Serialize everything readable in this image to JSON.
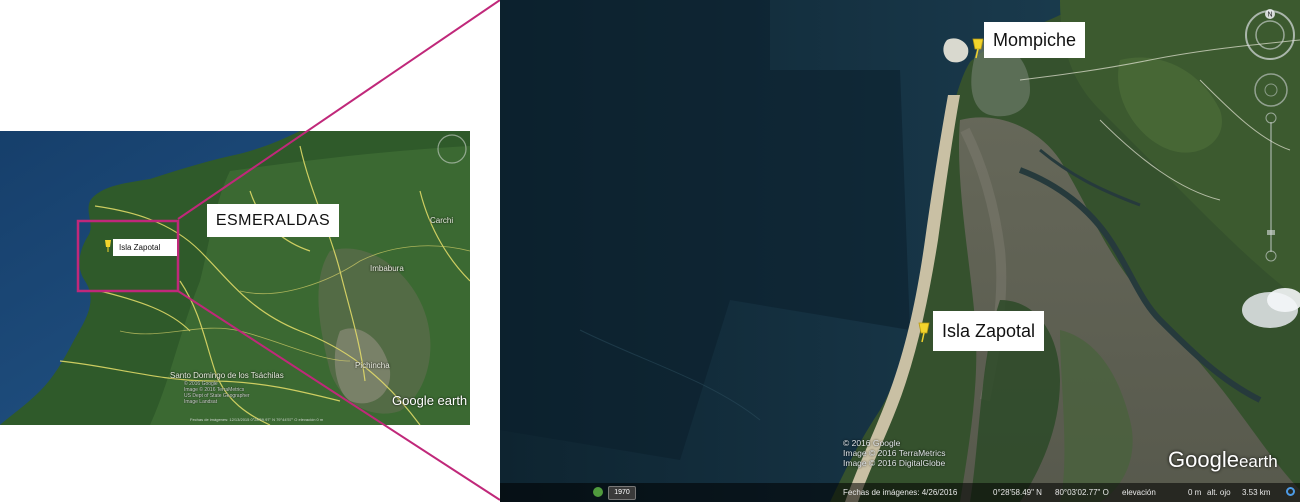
{
  "overview": {
    "region_label": "ESMERALDAS",
    "pin_label": "Isla Zapotal",
    "place_labels": [
      "Carchi",
      "Imbabura",
      "Pichincha",
      "Santo Domingo de los Tsáchilas"
    ],
    "brand": "Google earth",
    "credits": [
      "© 2016 Google",
      "Image © 2016 TerraMetrics",
      "US Dept of State Geographer",
      "Image Landsat"
    ],
    "status": "Fechas de imágenes: 12/13/2015   0°28'59.97\" N   79°44'57\" O   elevación 0 m"
  },
  "detail": {
    "mompiche_label": "Mompiche",
    "zapotal_label": "Isla Zapotal",
    "credits": [
      "© 2016 Google",
      "Image © 2016 TerraMetrics",
      "Image © 2016 DigitalGlobe"
    ],
    "brand_main": "Google",
    "brand_sub": "earth",
    "statusbar": {
      "year": "1970",
      "image_date": "Fechas de imágenes: 4/26/2016",
      "latitude": "0°28'58.49\" N",
      "longitude": "80°03'02.77\" O",
      "elevation": "elevación",
      "elevation_value": "0 m",
      "eye_altitude": "alt. ojo",
      "eye_altitude_value": "3.53 km"
    },
    "compass_letter": "N"
  },
  "colors": {
    "connector": "#c0287a",
    "highlight_box": "#c0287a",
    "pin": "#f2d42c",
    "road": "#e8e06a"
  }
}
